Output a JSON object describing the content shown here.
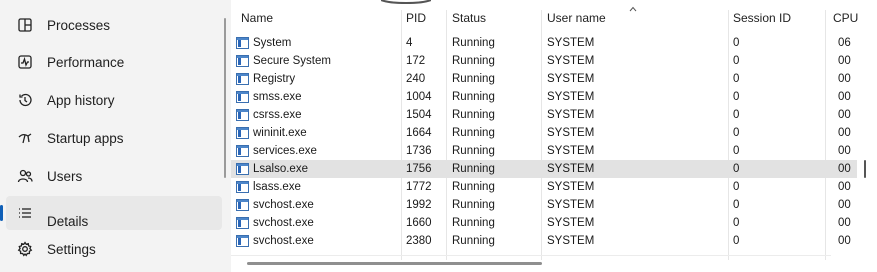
{
  "sidebar": {
    "items": [
      {
        "label": "Processes",
        "icon": "processes-icon"
      },
      {
        "label": "Performance",
        "icon": "performance-icon"
      },
      {
        "label": "App history",
        "icon": "app-history-icon"
      },
      {
        "label": "Startup apps",
        "icon": "startup-apps-icon"
      },
      {
        "label": "Users",
        "icon": "users-icon"
      },
      {
        "label": "Details",
        "icon": "details-icon"
      },
      {
        "label": "Settings",
        "icon": "settings-icon"
      }
    ],
    "selected": "Details"
  },
  "table": {
    "columns": [
      "Name",
      "PID",
      "Status",
      "User name",
      "Session ID",
      "CPU"
    ],
    "sorted_column": "User name",
    "rows": [
      {
        "name": "System",
        "pid": "4",
        "status": "Running",
        "user": "SYSTEM",
        "session": "0",
        "cpu": "06"
      },
      {
        "name": "Secure System",
        "pid": "172",
        "status": "Running",
        "user": "SYSTEM",
        "session": "0",
        "cpu": "00"
      },
      {
        "name": "Registry",
        "pid": "240",
        "status": "Running",
        "user": "SYSTEM",
        "session": "0",
        "cpu": "00"
      },
      {
        "name": "smss.exe",
        "pid": "1004",
        "status": "Running",
        "user": "SYSTEM",
        "session": "0",
        "cpu": "00"
      },
      {
        "name": "csrss.exe",
        "pid": "1504",
        "status": "Running",
        "user": "SYSTEM",
        "session": "0",
        "cpu": "00"
      },
      {
        "name": "wininit.exe",
        "pid": "1664",
        "status": "Running",
        "user": "SYSTEM",
        "session": "0",
        "cpu": "00"
      },
      {
        "name": "services.exe",
        "pid": "1736",
        "status": "Running",
        "user": "SYSTEM",
        "session": "0",
        "cpu": "00"
      },
      {
        "name": "Lsalso.exe",
        "pid": "1756",
        "status": "Running",
        "user": "SYSTEM",
        "session": "0",
        "cpu": "00",
        "highlighted": true
      },
      {
        "name": "lsass.exe",
        "pid": "1772",
        "status": "Running",
        "user": "SYSTEM",
        "session": "0",
        "cpu": "00"
      },
      {
        "name": "svchost.exe",
        "pid": "1992",
        "status": "Running",
        "user": "SYSTEM",
        "session": "0",
        "cpu": "00"
      },
      {
        "name": "svchost.exe",
        "pid": "1660",
        "status": "Running",
        "user": "SYSTEM",
        "session": "0",
        "cpu": "00"
      },
      {
        "name": "svchost.exe",
        "pid": "2380",
        "status": "Running",
        "user": "SYSTEM",
        "session": "0",
        "cpu": "00"
      }
    ]
  },
  "colors": {
    "accent": "#0f5fb7",
    "row_highlight": "#e2e2e2",
    "sidebar_bg": "#f3f3f3"
  }
}
